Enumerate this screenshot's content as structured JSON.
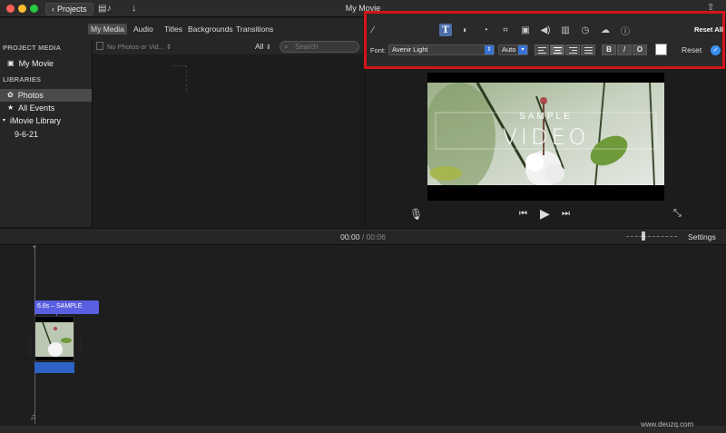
{
  "window": {
    "title": "My Movie",
    "projects_label": "Projects"
  },
  "tabs": [
    "My Media",
    "Audio",
    "Titles",
    "Backgrounds",
    "Transitions"
  ],
  "sidebar": {
    "project_media_heading": "PROJECT MEDIA",
    "project_item": "My Movie",
    "libraries_heading": "LIBRARIES",
    "items": [
      "Photos",
      "All Events",
      "iMovie Library",
      "9-6-21"
    ]
  },
  "browser": {
    "filter_placeholder": "No Photos or Vid...",
    "filter_value": "All",
    "search_placeholder": "Search"
  },
  "adjust": {
    "reset_all": "Reset All",
    "font_label": "Font:",
    "font_value": "Avenir Light",
    "size_value": "Auto",
    "bold": "B",
    "italic": "I",
    "outline": "O",
    "reset": "Reset",
    "text_color": "#ffffff",
    "highlight_color": "#d4141c"
  },
  "preview": {
    "title_line1": "SAMPLE",
    "title_line2": "VIDEO"
  },
  "timeline": {
    "current_time": "00:00",
    "separator": "/",
    "total_time": "00:06",
    "settings": "Settings",
    "clip_label": "6.8s – SAMPLE"
  },
  "watermark": "www.deuzq.com"
}
